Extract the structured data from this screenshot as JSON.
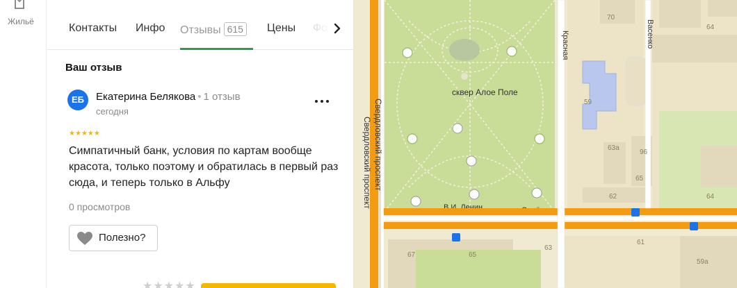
{
  "rail": {
    "housing_label": "Жильё"
  },
  "tabs": {
    "contacts": "Контакты",
    "info": "Инфо",
    "reviews": "Отзывы",
    "reviews_count": "615",
    "prices": "Цены",
    "photo": "Фо"
  },
  "review_section": {
    "title": "Ваш отзыв",
    "avatar_initials": "ЕБ",
    "author": "Екатерина Белякова",
    "author_reviews": "1 отзыв",
    "date": "сегодня",
    "rating_stars": "★★★★★",
    "rating": 5,
    "text": "Симпатичный банк, условия по картам вообще красота, только поэтому и обратилась в первый раз сюда, и теперь только в Альфу",
    "views": "0 просмотров",
    "useful_label": "Полезно?"
  },
  "rate_stars": "★★★★★",
  "map": {
    "labels": {
      "park": "сквер Алое Поле",
      "lenin": "В.И. Ленин",
      "orlenok": "Орлёнок",
      "avenue": "Свердловский проспект",
      "krasnaya": "Красная",
      "vasenko": "Васенко"
    },
    "house_numbers": [
      "70",
      "64",
      "59",
      "63а",
      "96",
      "65",
      "62",
      "63",
      "61",
      "67",
      "65",
      "59а",
      "64"
    ]
  },
  "colors": {
    "accent_green": "#2e9d4a",
    "avatar_blue": "#1a73e8",
    "star_yellow": "#f2b50f",
    "road_orange": "#f39c12",
    "park_green": "#c9dc98"
  }
}
